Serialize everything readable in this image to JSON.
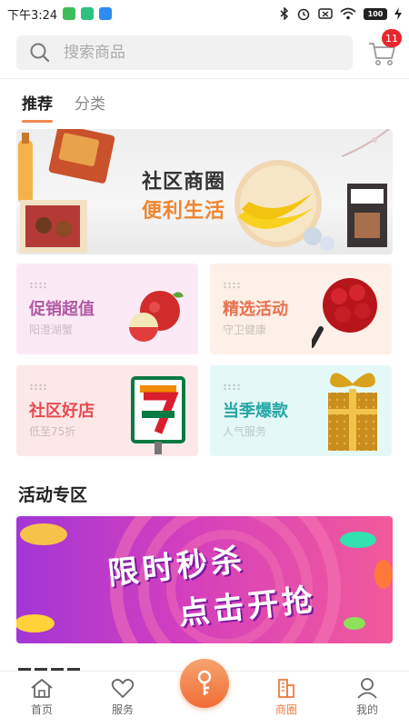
{
  "status_bar": {
    "time": "下午3:24",
    "battery": "100"
  },
  "search": {
    "placeholder": "搜索商品",
    "cart_count": "11"
  },
  "tabs": [
    {
      "label": "推荐",
      "active": true
    },
    {
      "label": "分类",
      "active": false
    }
  ],
  "banner": {
    "title": "社区商圈",
    "subtitle": "便利生活"
  },
  "cards": [
    {
      "title": "促销超值",
      "subtitle": "阳澄湖蟹",
      "color": "#b259a3"
    },
    {
      "title": "精选活动",
      "subtitle": "守卫健康",
      "color": "#e8714f"
    },
    {
      "title": "社区好店",
      "subtitle": "低至75折",
      "color": "#e84b4e"
    },
    {
      "title": "当季爆款",
      "subtitle": "人气服务",
      "color": "#27a7a6"
    }
  ],
  "section": {
    "title": "活动专区"
  },
  "promo": {
    "line1": "限时秒杀",
    "line2": "点击开抢"
  },
  "nav": [
    {
      "label": "首页",
      "icon": "home-icon",
      "active": false
    },
    {
      "label": "服务",
      "icon": "heart-icon",
      "active": false
    },
    {
      "label": "",
      "icon": "key-icon",
      "active": false
    },
    {
      "label": "商圈",
      "icon": "building-icon",
      "active": true
    },
    {
      "label": "我的",
      "icon": "user-icon",
      "active": false
    }
  ],
  "colors": {
    "accent": "#f07b3f",
    "badge": "#e8262b"
  }
}
